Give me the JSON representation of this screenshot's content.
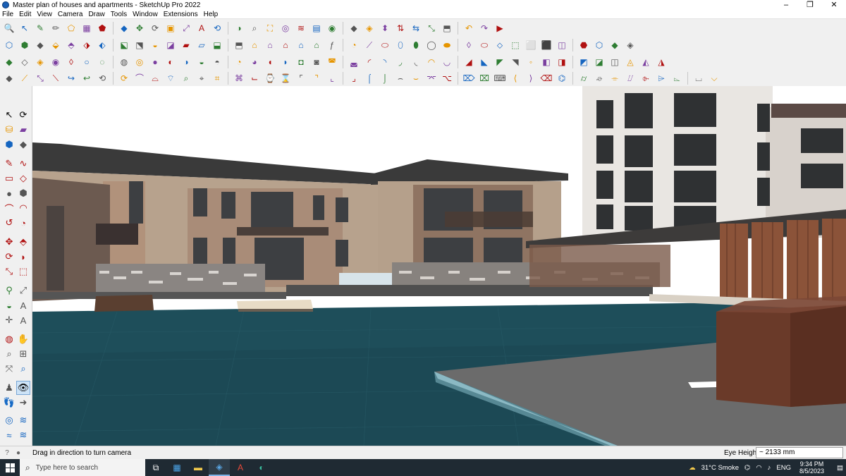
{
  "window": {
    "title": "Master plan of houses and apartments - SketchUp Pro 2022",
    "controls": [
      "–",
      "❐",
      "✕"
    ]
  },
  "menu": [
    "File",
    "Edit",
    "View",
    "Camera",
    "Draw",
    "Tools",
    "Window",
    "Extensions",
    "Help"
  ],
  "toolbar_icons": {
    "row1": [
      "🔍",
      "↖",
      "✎",
      "✏",
      "⬠",
      "▦",
      "⬟",
      "◆",
      "✥",
      "⟳",
      "▣",
      "⤢",
      "A",
      "⟲",
      "◑",
      "⌕",
      "⛶",
      "◎",
      "≋",
      "▤",
      "◉",
      "◆",
      "◈",
      "⬍",
      "⇅",
      "⇆",
      "⤡",
      "⬒",
      "↶",
      "↷",
      "▶"
    ],
    "row2": [
      "⬡",
      "⬢",
      "◆",
      "⬙",
      "⬘",
      "⬗",
      "⬖",
      "⬕",
      "⬔",
      "◒",
      "◪",
      "▰",
      "▱",
      "⬓",
      "⬒",
      "⌂",
      "⌂",
      "⌂",
      "⌂",
      "⌂",
      "ƒ",
      "◔",
      "⟋",
      "⬭",
      "⬯",
      "⬮",
      "◯",
      "⬬",
      "◊",
      "⬭",
      "⬦",
      "⬚",
      "⬜",
      "⬛",
      "◫",
      "⬣",
      "⬡",
      "◆",
      "◈"
    ],
    "row3": [
      "◆",
      "◇",
      "◈",
      "◉",
      "◊",
      "○",
      "◌",
      "◍",
      "◎",
      "●",
      "◐",
      "◑",
      "◒",
      "◓",
      "◔",
      "◕",
      "◖",
      "◗",
      "◘",
      "◙",
      "◚",
      "◛",
      "◜",
      "◝",
      "◞",
      "◟",
      "◠",
      "◡",
      "◢",
      "◣",
      "◤",
      "◥",
      "◦",
      "◧",
      "◨",
      "◩",
      "◪",
      "◫",
      "◬",
      "◭",
      "◮"
    ],
    "row4": [
      "◆",
      "⟋",
      "⤡",
      "⟍",
      "↪",
      "↩",
      "⟲",
      "⟳",
      "⌒",
      "⌓",
      "⌔",
      "⌕",
      "⌖",
      "⌗",
      "⌘",
      "⌙",
      "⌚",
      "⌛",
      "⌜",
      "⌝",
      "⌞",
      "⌟",
      "⌠",
      "⌡",
      "⌢",
      "⌣",
      "⌤",
      "⌥",
      "⌦",
      "⌧",
      "⌨",
      "⟨",
      "⟩",
      "⌫",
      "⌬",
      "⌭",
      "⌮",
      "⌯",
      "⌰",
      "⌱",
      "⌲",
      "⌳",
      "⌴",
      "⌵"
    ]
  },
  "status": {
    "message": "Drag in direction to turn camera",
    "eye_height_label": "Eye Height",
    "eye_height_value": "~ 2133 mm"
  },
  "taskbar": {
    "search_placeholder": "Type here to search",
    "weather": "31°C  Smoke",
    "language": "ENG",
    "time": "9:34 PM",
    "date": "8/5/2023"
  },
  "colors": {
    "sky": "#ffffff",
    "water": "#1d4c58",
    "roof": "#3a3a3a",
    "wall_tan": "#b9a791",
    "wall_brown": "#8d6f60",
    "timber": "#7a4a32",
    "deck": "#6d6d6d"
  }
}
